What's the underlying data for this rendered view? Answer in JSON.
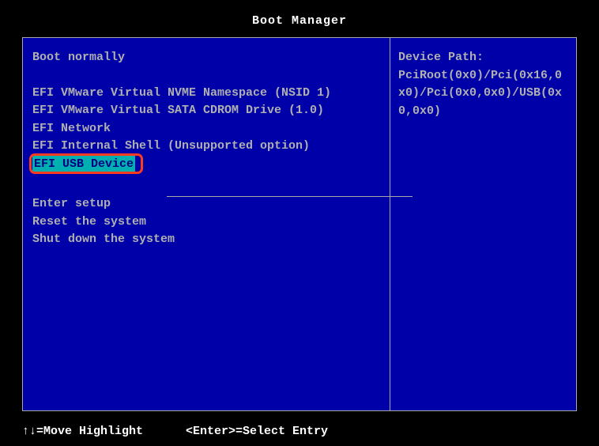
{
  "title": "Boot Manager",
  "menu": {
    "group1": [
      "Boot normally"
    ],
    "group2": [
      "EFI VMware Virtual NVME Namespace (NSID 1)",
      "EFI VMware Virtual SATA CDROM Drive (1.0)",
      "EFI Network",
      "EFI Internal Shell (Unsupported option)"
    ],
    "selected": "EFI USB Device",
    "group3": [
      "Enter setup",
      "Reset the system",
      "Shut down the system"
    ]
  },
  "detail": {
    "label": "Device Path:",
    "path": "PciRoot(0x0)/Pci(0x16,0x0)/Pci(0x0,0x0)/USB(0x0,0x0)"
  },
  "footer": {
    "hint1": "↑↓=Move Highlight",
    "hint2": "<Enter>=Select Entry"
  }
}
